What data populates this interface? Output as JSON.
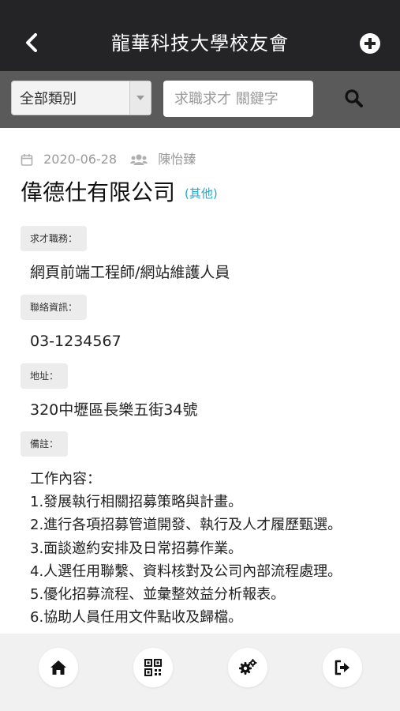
{
  "header": {
    "title": "龍華科技大學校友會",
    "back_icon": "chevron-left-icon",
    "add_icon": "plus-circle-icon"
  },
  "search": {
    "category_value": "全部類別",
    "placeholder": "求職求才 關鍵字",
    "search_icon": "search-icon"
  },
  "post": {
    "date": "2020-06-28",
    "author": "陳怡臻",
    "company": "偉德仕有限公司",
    "category": "(其他)",
    "position_label": "求才職務：",
    "position_value": "網頁前端工程師/網站維護人員",
    "contact_label": "聯絡資訊：",
    "contact_value": "03-1234567",
    "address_label": "地址：",
    "address_value": "320中壢區長樂五街34號",
    "notes_label": "備註：",
    "notes_lines": [
      "工作內容：",
      "1.發展執行相關招募策略與計畫。",
      "2.進行各項招募管道開發、執行及人才履歷甄選。",
      "3.面談邀約安排及日常招募作業。",
      "4.人選任用聯繫、資料核對及公司內部流程處理。",
      "5.優化招募流程、並彙整效益分析報表。",
      "6.協助人員任用文件點收及歸檔。"
    ]
  },
  "tabbar": {
    "items": [
      "home-icon",
      "qrcode-icon",
      "settings-icon",
      "logout-icon"
    ]
  },
  "colors": {
    "header_bg": "#242427",
    "searchbar_bg": "#5a5a5a",
    "category_accent": "#23a7c5",
    "tabbar_bg": "#f1f1f1"
  }
}
